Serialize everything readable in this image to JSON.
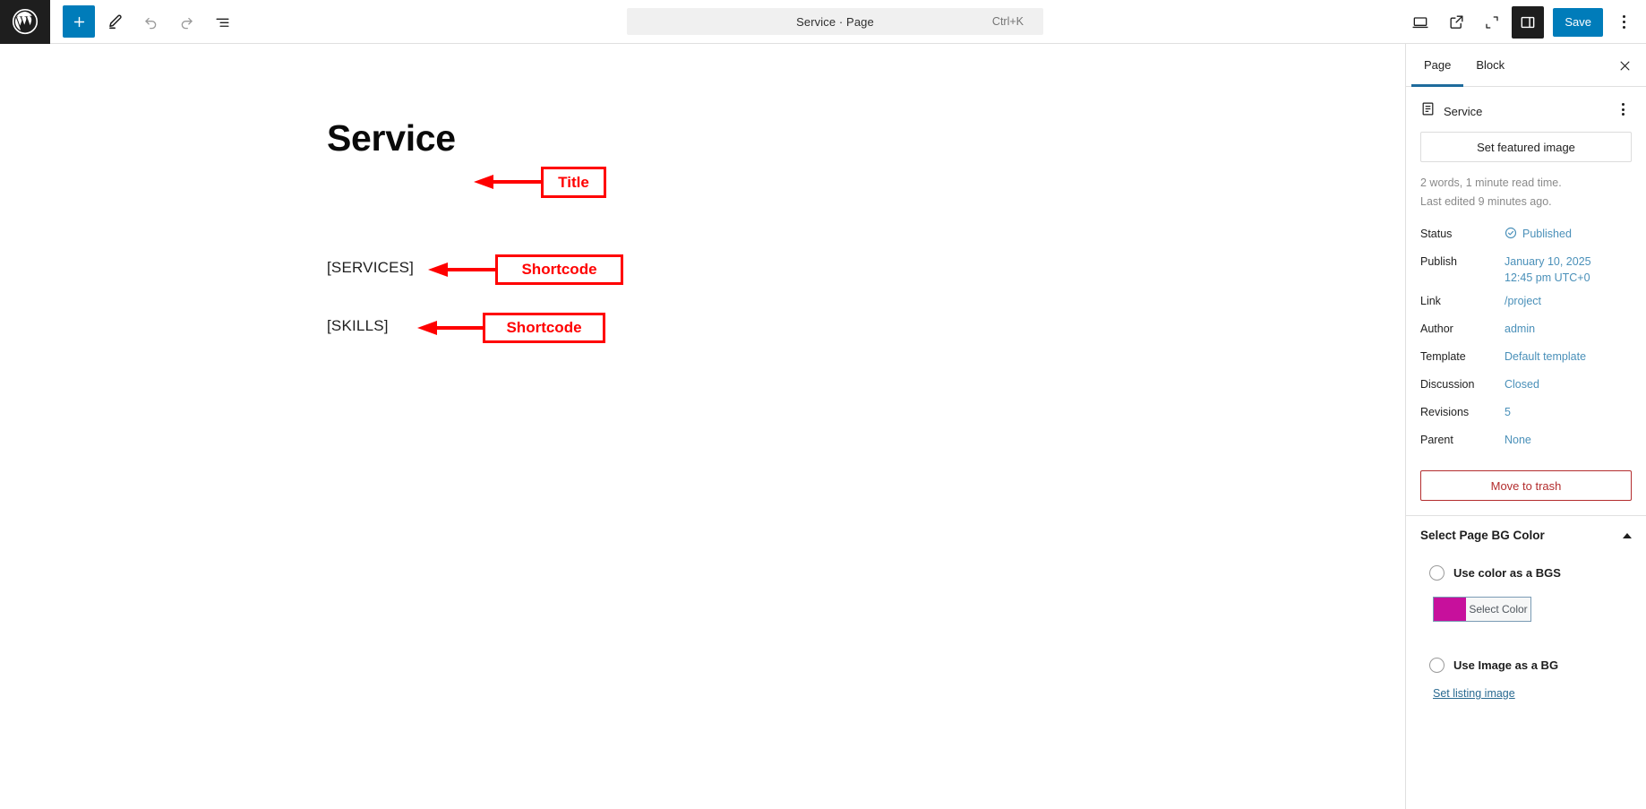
{
  "topbar": {
    "logo_icon": "wordpress-logo-icon",
    "add_block_label": "+",
    "tools_icon": "pencil-edit-icon",
    "undo_icon": "undo-arrow-icon",
    "redo_icon": "redo-arrow-icon",
    "list_view_icon": "document-list-view-icon",
    "command_title": "Service · Page",
    "command_shortcut": "Ctrl+K",
    "view_icon": "desktop-preview-icon",
    "external_icon": "view-external-link-icon",
    "fullscreen_icon": "zoom-out-collapse-icon",
    "settings_icon": "settings-sidebar-icon",
    "save_label": "Save",
    "options_icon": "more-options-kebab-icon",
    "accent_color": "#007cba",
    "logo_bg": "#1e1e1e"
  },
  "canvas": {
    "post_title": "Service",
    "shortcode_1": "[SERVICES]",
    "shortcode_2": "[SKILLS]"
  },
  "annotations": {
    "color": "#ff0000",
    "title_label": "Title",
    "shortcode_1_label": "Shortcode",
    "shortcode_2_label": "Shortcode"
  },
  "sidebar": {
    "tabs": [
      {
        "label": "Page",
        "active": true
      },
      {
        "label": "Block",
        "active": false
      }
    ],
    "close_icon": "close-x-icon",
    "document_icon": "page-document-icon",
    "document_name": "Service",
    "document_menu_icon": "more-options-kebab-icon",
    "featured_image_label": "Set featured image",
    "word_count_note": "2 words, 1 minute read time.",
    "last_edited_note": "Last edited 9 minutes ago.",
    "meta": [
      {
        "key": "Status",
        "value": "Published",
        "icon": "published-check-circle-icon"
      },
      {
        "key": "Publish",
        "value": "January 10, 2025",
        "value2": "12:45 pm UTC+0"
      },
      {
        "key": "Link",
        "value": "/project"
      },
      {
        "key": "Author",
        "value": "admin"
      },
      {
        "key": "Template",
        "value": "Default template"
      },
      {
        "key": "Discussion",
        "value": "Closed"
      },
      {
        "key": "Revisions",
        "value": "5"
      },
      {
        "key": "Parent",
        "value": "None"
      }
    ],
    "trash_label": "Move to trash",
    "trash_color": "#b32d2e",
    "link_color": "#4a90b9",
    "bg_panel": {
      "title": "Select Page BG Color",
      "collapse_icon": "chevron-up-icon",
      "radio_color_label": "Use color as a BGS",
      "select_color_label": "Select Color",
      "swatch_color": "#c7109c",
      "radio_image_label": "Use Image as a BG",
      "listing_image_label": "Set listing image"
    }
  }
}
